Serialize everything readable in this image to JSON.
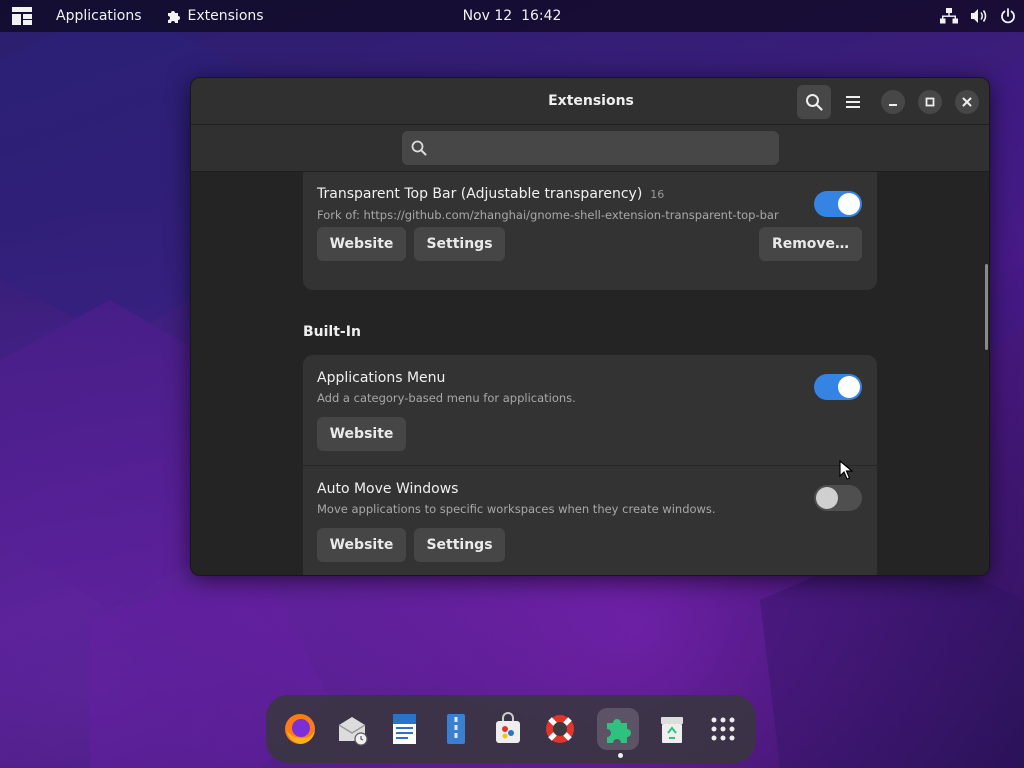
{
  "topbar": {
    "activities_icon": "activities-overview-icon",
    "applications": "Applications",
    "extensions": "Extensions",
    "clock": "Nov 12  16:42",
    "tray_icons": [
      "network-wired-icon",
      "volume-icon",
      "power-icon"
    ]
  },
  "window": {
    "title": "Extensions",
    "search_placeholder": "",
    "extensions": [
      {
        "name": "Transparent Top Bar (Adjustable transparency)",
        "version": "16",
        "description": "Fork of: https://github.com/zhanghai/gnome-shell-extension-transparent-top-bar",
        "enabled": true,
        "buttons": [
          "Website",
          "Settings"
        ],
        "remove_label": "Remove…"
      }
    ],
    "builtin_title": "Built-In",
    "builtin": [
      {
        "name": "Applications Menu",
        "description": "Add a category-based menu for applications.",
        "enabled": true,
        "buttons": [
          "Website"
        ]
      },
      {
        "name": "Auto Move Windows",
        "description": "Move applications to specific workspaces when they create windows.",
        "enabled": false,
        "buttons": [
          "Website",
          "Settings"
        ]
      }
    ]
  },
  "dock": {
    "apps": [
      "firefox-icon",
      "evolution-mail-icon",
      "writer-document-icon",
      "file-manager-icon",
      "software-store-icon",
      "help-lifebuoy-icon",
      "extensions-puzzle-icon",
      "trash-icon",
      "app-grid-icon"
    ],
    "active_app": "extensions-puzzle-icon"
  },
  "colors": {
    "accent": "#3584e4",
    "window_bg": "#242424",
    "card_bg": "#333333"
  }
}
